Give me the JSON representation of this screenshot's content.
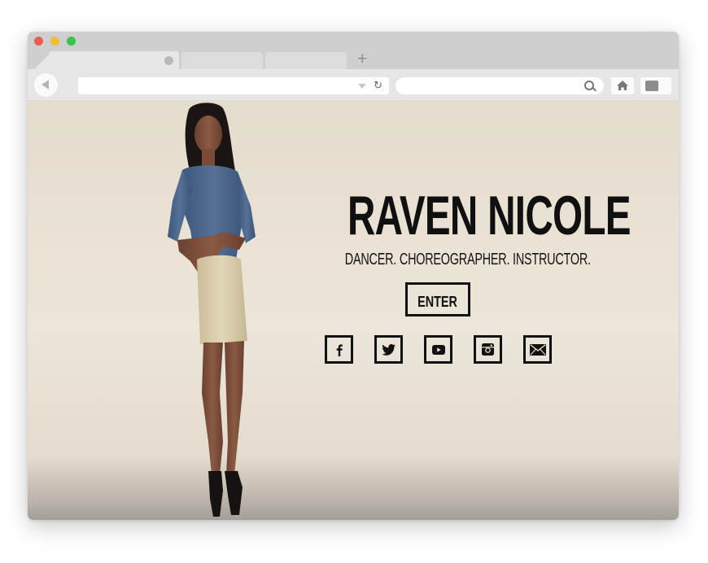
{
  "browser": {
    "traffic_lights": [
      "close",
      "minimize",
      "zoom"
    ],
    "new_tab_label": "+",
    "reload_glyph": "↻",
    "colors": {
      "close": "#ee5c54",
      "minimize": "#f3bd33",
      "zoom": "#38c54b"
    }
  },
  "page": {
    "title": "RAVEN NICOLE",
    "tagline": "DANCER. CHOREOGRAPHER. INSTRUCTOR.",
    "enter_label": "ENTER",
    "social": [
      {
        "name": "facebook",
        "icon": "facebook-icon"
      },
      {
        "name": "twitter",
        "icon": "twitter-icon"
      },
      {
        "name": "youtube",
        "icon": "youtube-icon"
      },
      {
        "name": "instagram",
        "icon": "instagram-icon"
      },
      {
        "name": "email",
        "icon": "envelope-icon"
      }
    ],
    "colors": {
      "background": "#e9e2d4",
      "text": "#101010"
    }
  }
}
